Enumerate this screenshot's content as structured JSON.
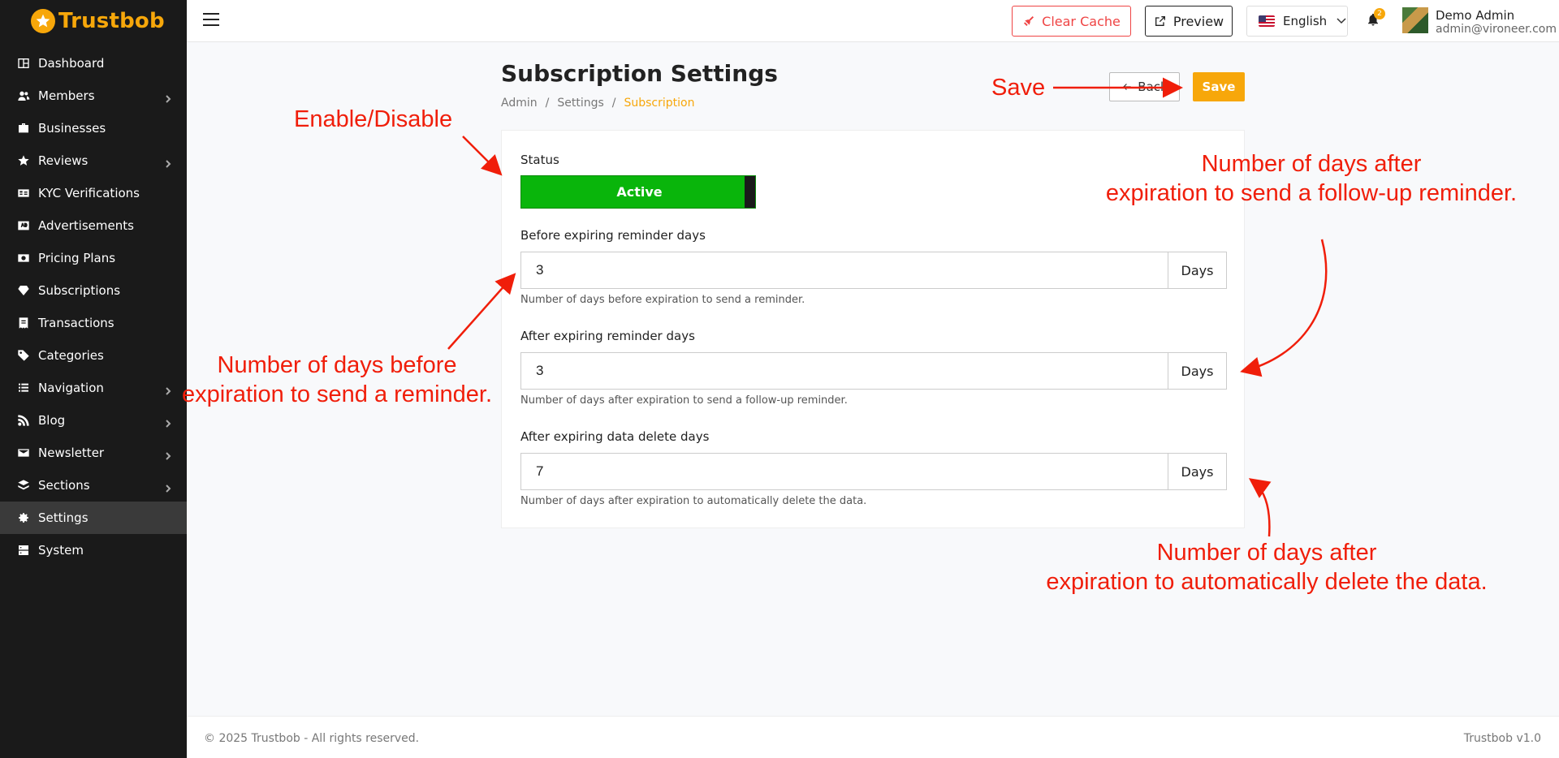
{
  "brand": {
    "name_part1": "Trust",
    "name_part2": "bob",
    "accent_color": "#f7a70a"
  },
  "sidebar": {
    "items": [
      {
        "label": "Dashboard",
        "icon": "dashboard-icon",
        "has_submenu": false
      },
      {
        "label": "Members",
        "icon": "users-icon",
        "has_submenu": true
      },
      {
        "label": "Businesses",
        "icon": "briefcase-icon",
        "has_submenu": false
      },
      {
        "label": "Reviews",
        "icon": "star-icon",
        "has_submenu": true
      },
      {
        "label": "KYC Verifications",
        "icon": "id-card-icon",
        "has_submenu": false
      },
      {
        "label": "Advertisements",
        "icon": "ad-icon",
        "has_submenu": false
      },
      {
        "label": "Pricing Plans",
        "icon": "money-icon",
        "has_submenu": false
      },
      {
        "label": "Subscriptions",
        "icon": "gem-icon",
        "has_submenu": false
      },
      {
        "label": "Transactions",
        "icon": "receipt-icon",
        "has_submenu": false
      },
      {
        "label": "Categories",
        "icon": "tags-icon",
        "has_submenu": false
      },
      {
        "label": "Navigation",
        "icon": "list-icon",
        "has_submenu": true
      },
      {
        "label": "Blog",
        "icon": "rss-icon",
        "has_submenu": true
      },
      {
        "label": "Newsletter",
        "icon": "envelope-icon",
        "has_submenu": true
      },
      {
        "label": "Sections",
        "icon": "layers-icon",
        "has_submenu": true
      },
      {
        "label": "Settings",
        "icon": "gear-icon",
        "has_submenu": false,
        "active": true
      },
      {
        "label": "System",
        "icon": "server-icon",
        "has_submenu": false
      }
    ]
  },
  "topbar": {
    "clear_cache_label": "Clear Cache",
    "preview_label": "Preview",
    "language": "English",
    "notification_count": "2",
    "user_name": "Demo Admin",
    "user_email": "admin@vironeer.com"
  },
  "page": {
    "title": "Subscription Settings",
    "breadcrumb": [
      "Admin",
      "Settings",
      "Subscription"
    ],
    "back_label": "Back",
    "save_label": "Save"
  },
  "form": {
    "status_label": "Status",
    "status_value": "Active",
    "fields": [
      {
        "label": "Before expiring reminder days",
        "value": "3",
        "suffix": "Days",
        "help": "Number of days before expiration to send a reminder."
      },
      {
        "label": "After expiring reminder days",
        "value": "3",
        "suffix": "Days",
        "help": "Number of days after expiration to send a follow-up reminder."
      },
      {
        "label": "After expiring data delete days",
        "value": "7",
        "suffix": "Days",
        "help": "Number of days after expiration to automatically delete the data."
      }
    ]
  },
  "annotations": {
    "save": "Save",
    "enable": "Enable/Disable",
    "before_line1": "Number of days before",
    "before_line2": "expiration to send a reminder.",
    "after_line1": "Number of days after",
    "after_line2": "expiration to send a follow-up reminder.",
    "delete_line1": "Number of days after",
    "delete_line2": "expiration to automatically delete the data.",
    "color": "#f01e0a"
  },
  "footer": {
    "copyright": "© 2025 Trustbob - All rights reserved.",
    "version": "Trustbob v1.0"
  }
}
